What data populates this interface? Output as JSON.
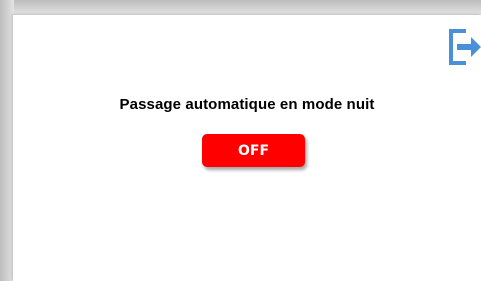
{
  "panel": {
    "title": "Passage automatique en mode nuit"
  },
  "toggle": {
    "label": "OFF",
    "color": "#ff0000"
  },
  "exit": {
    "icon": "exit-icon",
    "color": "#4a90d9"
  }
}
